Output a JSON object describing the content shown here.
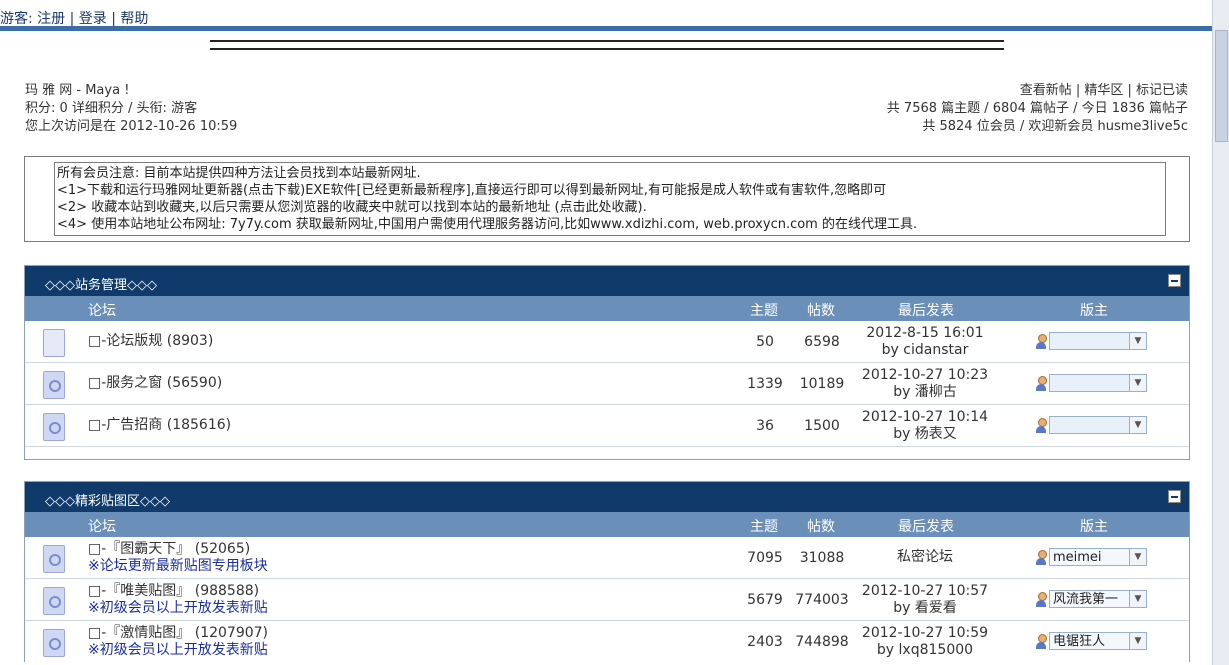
{
  "topbar": {
    "guest": "游客",
    "colon": ": ",
    "register": "注册",
    "sep": " | ",
    "login": "登录",
    "help": "帮助"
  },
  "info_left": {
    "site": "玛 雅 网 - Maya !",
    "score": "积分: 0 详细积分 / 头衔: 游客",
    "last_visit": "您上次访问是在 2012-10-26 10:59"
  },
  "info_right": {
    "links": "查看新帖 | 精华区 | 标记已读",
    "stats": "共 7568 篇主题 / 6804 篇帖子 / 今日 1836 篇帖子",
    "members": "共 5824 位会员 / 欢迎新会员 husme3live5c"
  },
  "notice": [
    "所有会员注意: 目前本站提供四种方法让会员找到本站最新网址.",
    "<1>下载和运行玛雅网址更新器(点击下载)EXE软件[已经更新最新程序],直接运行即可以得到最新网址,有可能报是成人软件或有害软件,忽略即可",
    "<2> 收藏本站到收藏夹,以后只需要从您浏览器的收藏夹中就可以找到本站的最新地址 (点击此处收藏).",
    "<4> 使用本站地址公布网址: 7y7y.com 获取最新网址,中国用户需使用代理服务器访问,比如www.xdizhi.com, web.proxycn.com 的在线代理工具."
  ],
  "columns": {
    "forum": "论坛",
    "topics": "主题",
    "posts": "帖数",
    "last": "最后发表",
    "moderator": "版主"
  },
  "sections": [
    {
      "title": "◇◇◇站务管理◇◇◇",
      "rows": [
        {
          "name": "□-论坛版规 (8903)",
          "sub": "",
          "topics": "50",
          "posts": "6598",
          "last_time": "2012-8-15 16:01",
          "last_by": "by cidanstar",
          "mod": ""
        },
        {
          "name": "□-服务之窗 (56590)",
          "sub": "",
          "topics": "1339",
          "posts": "10189",
          "last_time": "2012-10-27 10:23",
          "last_by": "by 潘柳古",
          "mod": ""
        },
        {
          "name": "□-广告招商 (185616)",
          "sub": "",
          "topics": "36",
          "posts": "1500",
          "last_time": "2012-10-27 10:14",
          "last_by": "by 杨表又",
          "mod": ""
        }
      ]
    },
    {
      "title": "◇◇◇精彩贴图区◇◇◇",
      "rows": [
        {
          "name": "□-『图霸天下』 (52065)",
          "sub": "※论坛更新最新贴图专用板块",
          "topics": "7095",
          "posts": "31088",
          "last_time": "私密论坛",
          "last_by": "",
          "mod": "meimei"
        },
        {
          "name": "□-『唯美贴图』 (988588)",
          "sub": "※初级会员以上开放发表新贴",
          "topics": "5679",
          "posts": "774003",
          "last_time": "2012-10-27 10:57",
          "last_by": "by 看爱看",
          "mod": "风流我第一"
        },
        {
          "name": "□-『激情贴图』 (1207907)",
          "sub": "※初级会员以上开放发表新贴",
          "topics": "2403",
          "posts": "744898",
          "last_time": "2012-10-27 10:59",
          "last_by": "by lxq815000",
          "mod": "电锯狂人"
        }
      ]
    }
  ]
}
